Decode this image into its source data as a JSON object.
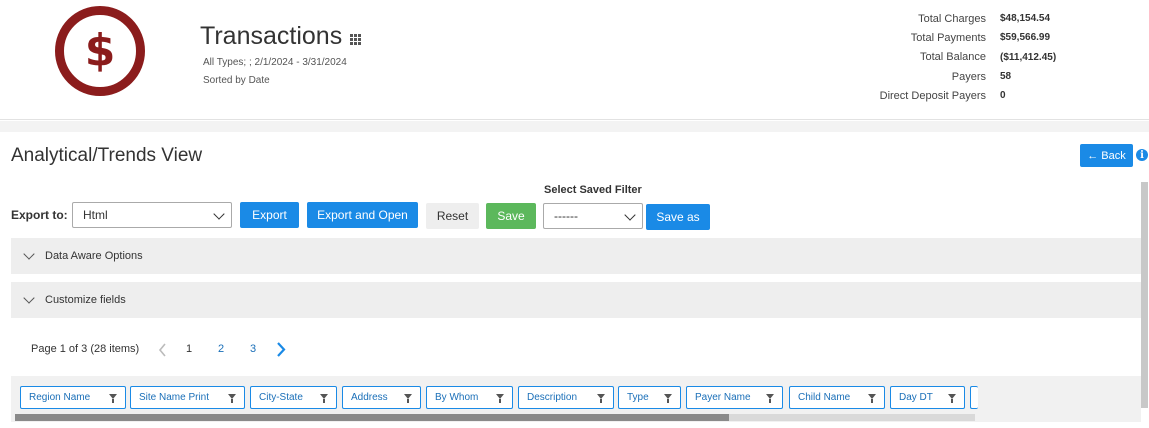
{
  "header": {
    "logo_symbol": "$",
    "title": "Transactions",
    "subtitle_filters": "All Types; ; 2/1/2024 - 3/31/2024",
    "subtitle_sort": "Sorted by Date",
    "totals": [
      {
        "label": "Total Charges",
        "value": "$48,154.54"
      },
      {
        "label": "Total Payments",
        "value": "$59,566.99"
      },
      {
        "label": "Total Balance",
        "value": "($11,412.45)"
      },
      {
        "label": "Payers",
        "value": "58"
      },
      {
        "label": "Direct Deposit Payers",
        "value": "0"
      }
    ]
  },
  "view": {
    "heading": "Analytical/Trends View",
    "back_label": "← Back",
    "info_symbol": "i"
  },
  "toolbar": {
    "export_label": "Export to:",
    "export_format": "Html",
    "export_button": "Export",
    "export_open_button": "Export and Open",
    "reset_button": "Reset",
    "save_button": "Save",
    "saved_filter_label": "Select Saved Filter",
    "saved_filter_value": "------",
    "save_as_button": "Save as"
  },
  "panels": {
    "data_aware": "Data Aware Options",
    "customize": "Customize fields"
  },
  "pager": {
    "summary": "Page 1 of 3 (28 items)",
    "pages": [
      "1",
      "2",
      "3"
    ],
    "current": "1"
  },
  "columns": [
    "Region Name",
    "Site Name Print",
    "City-State",
    "Address",
    "By Whom",
    "Description",
    "Type",
    "Payer Name",
    "Child Name",
    "Day DT"
  ],
  "colors": {
    "brand": "#8b1c1c",
    "accent": "#1a8ae6",
    "save": "#5cb85c"
  }
}
